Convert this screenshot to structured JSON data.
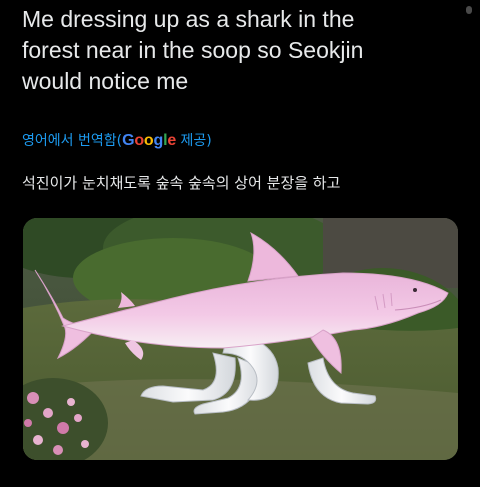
{
  "tweet": {
    "text": "Me dressing up as a shark in the\nforest near in the soop so Seokjin\nwould notice me",
    "translate_prefix": "영어에서 번역함",
    "google_open": "(",
    "google_letters": [
      {
        "char": "G",
        "color": "#4285f4"
      },
      {
        "char": "o",
        "color": "#ea4335"
      },
      {
        "char": "o",
        "color": "#fbbc05"
      },
      {
        "char": "g",
        "color": "#4285f4"
      },
      {
        "char": "l",
        "color": "#34a853"
      },
      {
        "char": "e",
        "color": "#ea4335"
      }
    ],
    "translate_suffix": " 제공)",
    "translated_text": "석진이가 눈치채도록 숲속 숲속의 상어 분장을 하고"
  },
  "colors": {
    "background": "#000000",
    "text": "#e7e9ea",
    "link": "#1d9bf0",
    "shark": "#f2c7e4",
    "shark_belly": "#f8f4f6",
    "grass": "#3f5a2c"
  },
  "media": {
    "subject": "pink-shark-statue-with-human-legs"
  }
}
